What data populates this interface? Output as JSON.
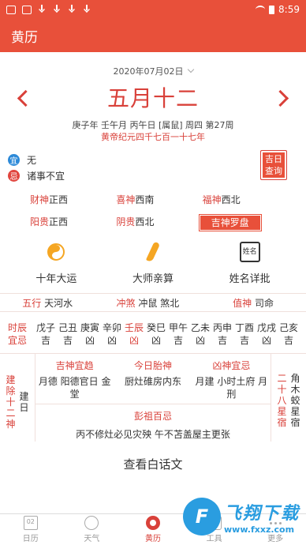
{
  "status_bar": {
    "time": "8:59"
  },
  "app_bar": {
    "title": "黄历"
  },
  "header": {
    "solar_date": "2020年07月02日",
    "lunar_date": "五月十二",
    "ganzhi": "庚子年 壬午月 丙午日 [属鼠] 周四 第27周",
    "era": "黄帝纪元四千七百一十七年"
  },
  "yiji": {
    "yi_badge": "宜",
    "yi_text": "无",
    "ji_badge": "忌",
    "ji_text": "诸事不宜",
    "query_line1": "吉日",
    "query_line2": "查询"
  },
  "gods": [
    {
      "label": "财神",
      "value": "正西"
    },
    {
      "label": "喜神",
      "value": "西南"
    },
    {
      "label": "福神",
      "value": "西北"
    },
    {
      "label": "阳贵",
      "value": "正西"
    },
    {
      "label": "阴贵",
      "value": "西北"
    }
  ],
  "compass_button": "吉神罗盘",
  "features": [
    {
      "label": "十年大运",
      "icon": "taiji-icon"
    },
    {
      "label": "大师亲算",
      "icon": "brush-icon"
    },
    {
      "label": "姓名详批",
      "icon": "name-seal-icon",
      "icon_text": "姓名"
    }
  ],
  "five_row": [
    {
      "label": "五行",
      "value": "天河水"
    },
    {
      "label": "冲煞",
      "value": "冲鼠 煞北"
    },
    {
      "label": "值神",
      "value": "司命"
    }
  ],
  "hours": {
    "label_line1": "时辰",
    "label_line2": "宜忌",
    "items": [
      {
        "name": "戊子",
        "luck": "吉"
      },
      {
        "name": "己丑",
        "luck": "吉"
      },
      {
        "name": "庚寅",
        "luck": "凶"
      },
      {
        "name": "辛卯",
        "luck": "凶"
      },
      {
        "name": "壬辰",
        "luck": "凶"
      },
      {
        "name": "癸巳",
        "luck": "凶"
      },
      {
        "name": "甲午",
        "luck": "吉"
      },
      {
        "name": "乙未",
        "luck": "凶"
      },
      {
        "name": "丙申",
        "luck": "吉"
      },
      {
        "name": "丁酉",
        "luck": "吉"
      },
      {
        "name": "戊戌",
        "luck": "凶"
      },
      {
        "name": "己亥",
        "luck": "吉"
      }
    ],
    "current_index": 4
  },
  "jianchu": {
    "label": "建除十二神",
    "value": "建日"
  },
  "jishen": {
    "title": "吉神宜趋",
    "text": "月德 阳德官日 金堂"
  },
  "taishen": {
    "title": "今日胎神",
    "text": "厨灶碓房内东"
  },
  "xiongshen": {
    "title": "凶神宜忌",
    "text": "月建 小时土府 月刑"
  },
  "pengzu": {
    "title": "彭祖百忌",
    "text": "丙不修灶必见灾殃 午不苫盖屋主更张"
  },
  "xingxiu": {
    "label": "二十八星宿",
    "value": "角木蛟星宿"
  },
  "vernacular_link": "查看白话文",
  "tabs": [
    {
      "label": "日历",
      "icon_text": "02"
    },
    {
      "label": "天气"
    },
    {
      "label": "黄历"
    },
    {
      "label": "工具"
    },
    {
      "label": "更多"
    }
  ],
  "watermark": {
    "logo": "F",
    "big": "飞翔下载",
    "small": "www.fxxz.com"
  }
}
